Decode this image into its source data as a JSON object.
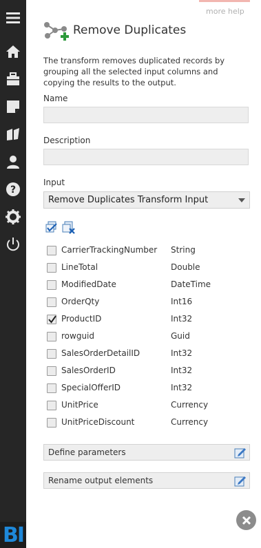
{
  "header": {
    "more_help": "more help",
    "title": "Remove Duplicates",
    "description": "The transform removes duplicated records by grouping all the selected input columns and copying the results to the output."
  },
  "form": {
    "name_label": "Name",
    "name_value": "",
    "description_label": "Description",
    "description_value": "",
    "input_label": "Input",
    "input_selected": "Remove Duplicates Transform Input"
  },
  "columns": [
    {
      "name": "CarrierTrackingNumber",
      "type": "String",
      "checked": false
    },
    {
      "name": "LineTotal",
      "type": "Double",
      "checked": false
    },
    {
      "name": "ModifiedDate",
      "type": "DateTime",
      "checked": false
    },
    {
      "name": "OrderQty",
      "type": "Int16",
      "checked": false
    },
    {
      "name": "ProductID",
      "type": "Int32",
      "checked": true
    },
    {
      "name": "rowguid",
      "type": "Guid",
      "checked": false
    },
    {
      "name": "SalesOrderDetailID",
      "type": "Int32",
      "checked": false
    },
    {
      "name": "SalesOrderID",
      "type": "Int32",
      "checked": false
    },
    {
      "name": "SpecialOfferID",
      "type": "Int32",
      "checked": false
    },
    {
      "name": "UnitPrice",
      "type": "Currency",
      "checked": false
    },
    {
      "name": "UnitPriceDiscount",
      "type": "Currency",
      "checked": false
    }
  ],
  "actions": {
    "define_parameters": "Define parameters",
    "rename_output": "Rename output elements"
  },
  "sidebar_icons": [
    "menu-icon",
    "home-icon",
    "briefcase-icon",
    "note-icon",
    "book-icon",
    "user-icon",
    "help-icon",
    "gear-icon",
    "power-icon"
  ],
  "logo_text": "BI",
  "colors": {
    "sidebar": "#262626",
    "accent_green": "#2e9a3c",
    "accent_blue": "#1e88d9",
    "field_bg": "#eeeeee"
  }
}
